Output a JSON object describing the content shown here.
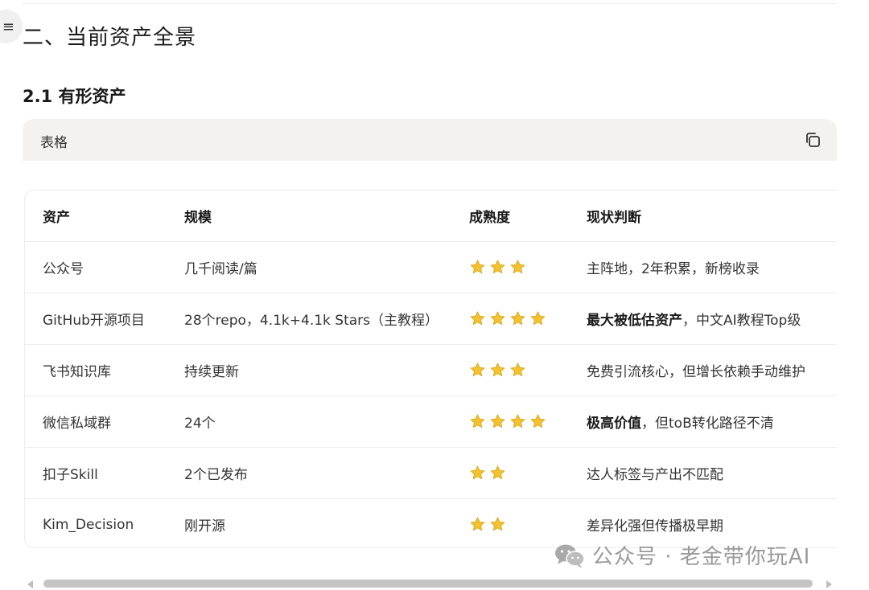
{
  "section_title": "二、当前资产全景",
  "subsection_title": "2.1 有形资产",
  "card": {
    "title": "表格",
    "copy_icon": "copy-icon"
  },
  "table": {
    "headers": [
      "资产",
      "规模",
      "成熟度",
      "现状判断"
    ],
    "rows": [
      {
        "asset": "公众号",
        "scale": "几千阅读/篇",
        "stars": 3,
        "status_bold": "",
        "status_rest": "主阵地，2年积累，新榜收录"
      },
      {
        "asset": "GitHub开源项目",
        "scale": "28个repo，4.1k+4.1k Stars（主教程）",
        "stars": 4,
        "status_bold": "最大被低估资产",
        "status_rest": "，中文AI教程Top级"
      },
      {
        "asset": "飞书知识库",
        "scale": "持续更新",
        "stars": 3,
        "status_bold": "",
        "status_rest": "免费引流核心，但增长依赖手动维护"
      },
      {
        "asset": "微信私域群",
        "scale": "24个",
        "stars": 4,
        "status_bold": "极高价值",
        "status_rest": "，但toB转化路径不清"
      },
      {
        "asset": "扣子Skill",
        "scale": "2个已发布",
        "stars": 2,
        "status_bold": "",
        "status_rest": "达人标签与产出不匹配"
      },
      {
        "asset": "Kim_Decision",
        "scale": "刚开源",
        "stars": 2,
        "status_bold": "",
        "status_rest": "差异化强但传播极早期"
      }
    ]
  },
  "watermark": {
    "text": "公众号 · 老金带你玩AI",
    "icon": "wechat-icon"
  },
  "colors": {
    "star": "#f2c230",
    "header_bg": "#f3f2ee",
    "border": "#ececec"
  }
}
